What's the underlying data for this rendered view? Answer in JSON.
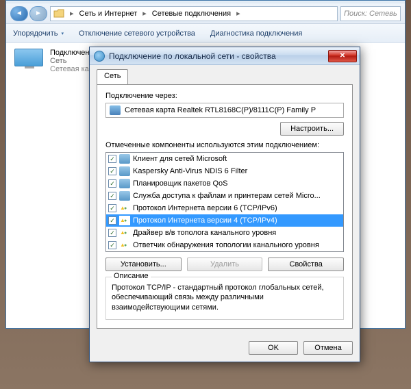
{
  "breadcrumb": {
    "part1": "Сеть и Интернет",
    "part2": "Сетевые подключения"
  },
  "search": {
    "placeholder": "Поиск: Сетевь"
  },
  "toolbar": {
    "organize": "Упорядочить",
    "disable": "Отключение сетевого устройства",
    "diagnose": "Диагностика подключения"
  },
  "connection": {
    "title": "Подключение",
    "line1": "Сеть",
    "line2": "Сетевая карта"
  },
  "dialog": {
    "title": "Подключение по локальной сети - свойства",
    "tab": "Сеть",
    "connectVia": "Подключение через:",
    "adapter": "Сетевая карта Realtek RTL8168C(P)/8111C(P) Family P",
    "configure": "Настроить...",
    "componentsLabel": "Отмеченные компоненты используются этим подключением:",
    "items": [
      "Клиент для сетей Microsoft",
      "Kaspersky Anti-Virus NDIS 6 Filter",
      "Планировщик пакетов QoS",
      "Служба доступа к файлам и принтерам сетей Micro...",
      "Протокол Интернета версии 6 (TCP/IPv6)",
      "Протокол Интернета версии 4 (TCP/IPv4)",
      "Драйвер в/в тополога канального уровня",
      "Ответчик обнаружения топологии канального уровня"
    ],
    "install": "Установить...",
    "uninstall": "Удалить",
    "properties": "Свойства",
    "descLegend": "Описание",
    "descText": "Протокол TCP/IP - стандартный протокол глобальных сетей, обеспечивающий связь между различными взаимодействующими сетями.",
    "ok": "OK",
    "cancel": "Отмена"
  }
}
